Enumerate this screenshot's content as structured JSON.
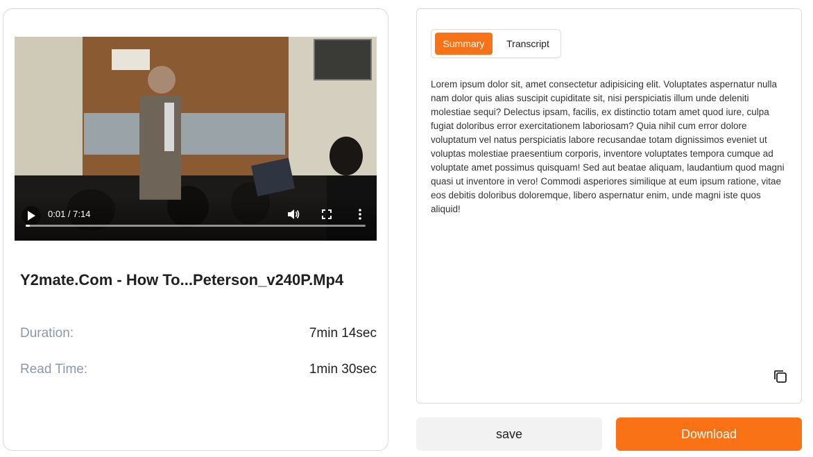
{
  "video": {
    "time_display": "0:01 / 7:14",
    "progress": 0.002,
    "title": "Y2mate.Com - How To...Peterson_v240P.Mp4"
  },
  "meta": {
    "duration_label": "Duration:",
    "duration_value": "7min 14sec",
    "read_time_label": "Read Time:",
    "read_time_value": "1min 30sec"
  },
  "tabs": {
    "summary_label": "Summary",
    "transcript_label": "Transcript",
    "active": "Summary"
  },
  "summary_text": "Lorem ipsum dolor sit, amet consectetur adipisicing elit. Voluptates aspernatur nulla nam dolor quis alias suscipit cupiditate sit, nisi perspiciatis illum unde deleniti molestiae sequi? Delectus ipsam, facilis, ex distinctio totam amet quod iure, culpa fugiat doloribus error exercitationem laboriosam? Quia nihil cum error dolore voluptatum vel natus perspiciatis labore recusandae totam dignissimos eveniet ut voluptas molestiae praesentium corporis, inventore voluptates tempora cumque ad voluptate amet possimus quisquam! Sed aut beatae aliquam, laudantium quod magni quasi ut inventore in vero! Commodi asperiores similique at eum ipsum ratione, vitae eos debitis doloribus doloremque, libero aspernatur enim, unde magni iste quos aliquid!",
  "buttons": {
    "save_label": "save",
    "download_label": "Download"
  },
  "colors": {
    "accent": "#f97316",
    "muted_label": "#8d98ab"
  },
  "icons": [
    "play-icon",
    "volume-icon",
    "fullscreen-icon",
    "more-options-icon",
    "copy-icon"
  ]
}
